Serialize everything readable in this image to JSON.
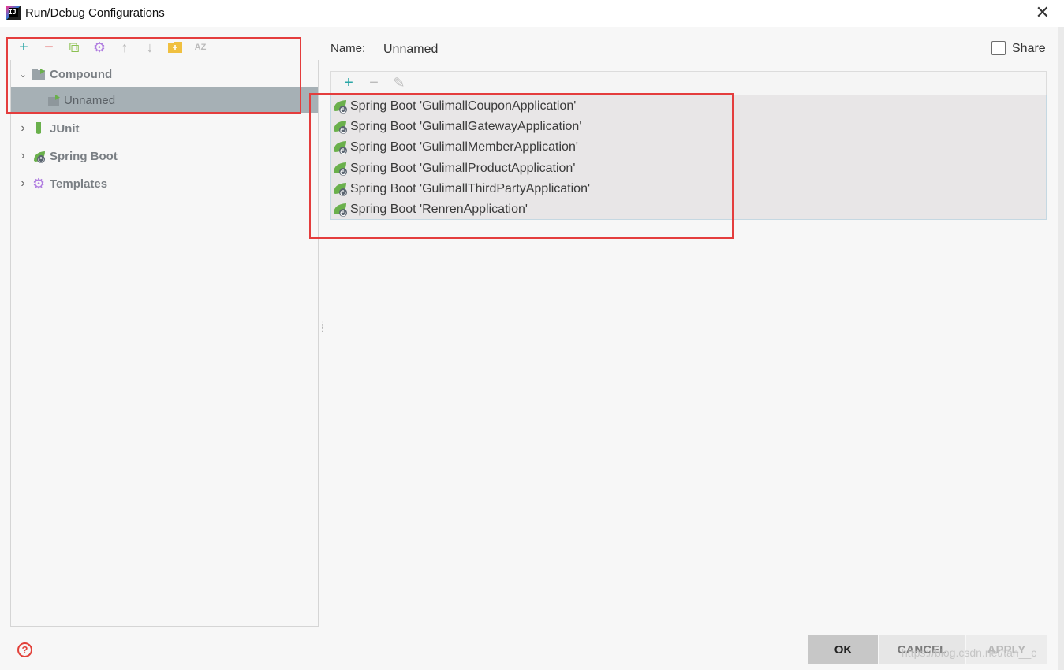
{
  "window": {
    "title": "Run/Debug Configurations",
    "app_icon_text": "IJ",
    "close_symbol": "✕"
  },
  "left_toolbar": {
    "items": [
      {
        "name": "add-icon",
        "glyph": "+",
        "color": "#2aa6a6"
      },
      {
        "name": "remove-icon",
        "glyph": "−",
        "color": "#e04a4a"
      },
      {
        "name": "copy-icon",
        "glyph": "⧉",
        "color": "#8cc152"
      },
      {
        "name": "settings-gear-icon",
        "glyph": "⚙",
        "color": "#b07de0"
      },
      {
        "name": "move-up-icon",
        "glyph": "↑",
        "color": "#b8b8b8"
      },
      {
        "name": "move-down-icon",
        "glyph": "↓",
        "color": "#b8b8b8"
      },
      {
        "name": "new-folder-icon",
        "glyph": "▬",
        "color": "#f0c040"
      },
      {
        "name": "sort-az-icon",
        "glyph": "AZ",
        "color": "#bbbbbb"
      }
    ]
  },
  "tree": {
    "compound": {
      "label": "Compound",
      "chevron": "⌄"
    },
    "compound_child": {
      "label": "Unnamed"
    },
    "junit": {
      "label": "JUnit",
      "chevron": "›"
    },
    "spring_boot": {
      "label": "Spring Boot",
      "chevron": "›"
    },
    "templates": {
      "label": "Templates",
      "chevron": "›"
    }
  },
  "config": {
    "name_label": "Name:",
    "name_value": "Unnamed",
    "share_label": "Share"
  },
  "list_toolbar": {
    "add": "+",
    "remove": "−",
    "edit": "✎"
  },
  "configurations": [
    {
      "label": "Spring Boot 'GulimallCouponApplication'"
    },
    {
      "label": "Spring Boot 'GulimallGatewayApplication'"
    },
    {
      "label": "Spring Boot 'GulimallMemberApplication'"
    },
    {
      "label": "Spring Boot 'GulimallProductApplication'"
    },
    {
      "label": "Spring Boot 'GulimallThirdPartyApplication'"
    },
    {
      "label": "Spring Boot 'RenrenApplication'"
    }
  ],
  "footer": {
    "help": "?",
    "ok": "OK",
    "cancel": "CANCEL",
    "apply": "APPLY",
    "watermark": "https://blog.csdn.net/tan__c"
  },
  "colors": {
    "selection": "#a6b0b5",
    "annotation_red": "#e43d3d",
    "spring_green": "#6ab04c"
  }
}
